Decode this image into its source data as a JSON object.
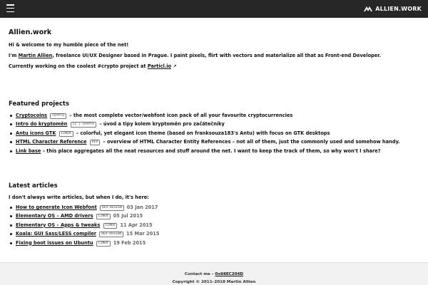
{
  "brand": {
    "name": "ALLIEN.WORK"
  },
  "header": {
    "title": "Allien.work"
  },
  "intro": {
    "line1": "Hi & welcome to my humble piece of the net!",
    "line2_prefix": "I'm ",
    "line2_name": "Martin Allien",
    "line2_suffix": ", freelance UI/UX Designer based in Prague. I paint pixels, flirt with vectors and materialize all that as Front-end Developer.",
    "line3_prefix": "Currently working on the coolest #crypto project at ",
    "line3_link": "Particl.io",
    "line3_ext": "↗"
  },
  "projects": {
    "title": "Featured projects",
    "items": [
      {
        "name": "Cryptocoins",
        "tag": "CRYPTO",
        "desc": " – the most complete vector/webfont icon pack of all your favourite cryptocurrencies"
      },
      {
        "name": "Intro do kryptoměn",
        "tag": "CZ | CRYPTO",
        "desc": " – úvod a tipy kolem kryptoměn pro začátečníky"
      },
      {
        "name": "Antu icons GTK",
        "tag": "LINUX",
        "desc": " – colorful, yet elegant icon theme (based on franksouza183's Antu) with focus on GTK desktops"
      },
      {
        "name": "HTML Character Reference",
        "tag": "DEV",
        "desc": " – overview of HTML Character Entity References – not all of them, just the commonly used and somehow handy."
      },
      {
        "name": "Link base",
        "tag": "",
        "desc": " – this place aggregates all the neat resources and stuff around the net. I want to keep the track of them, so why won't I share?"
      }
    ]
  },
  "articles": {
    "title": "Latest articles",
    "intro": "I don't always write articles, but when I do, it's here:",
    "items": [
      {
        "name": "How to generate Icon Webfont",
        "tag": "DEV·DESIGN",
        "date": "03 Jan 2017"
      },
      {
        "name": "Elementary OS – AMD drivers",
        "tag": "LINUX",
        "date": "05 Jul 2015"
      },
      {
        "name": "Elementary OS – Apps & tweaks",
        "tag": "LINUX",
        "date": "11 Apr 2015"
      },
      {
        "name": "Koala: GUI Sass/LESS compiler",
        "tag": "DEV·DESIGN",
        "date": "15 Mar 2015"
      },
      {
        "name": "Fixing boot issues on Ubuntu",
        "tag": "LINUX",
        "date": "19 Feb 2015"
      }
    ]
  },
  "footer": {
    "contact_prefix": "Contact me – ",
    "contact_link": "0x98EC204D",
    "copyright": "Copyright © 2011–2018  Martin Allien"
  }
}
